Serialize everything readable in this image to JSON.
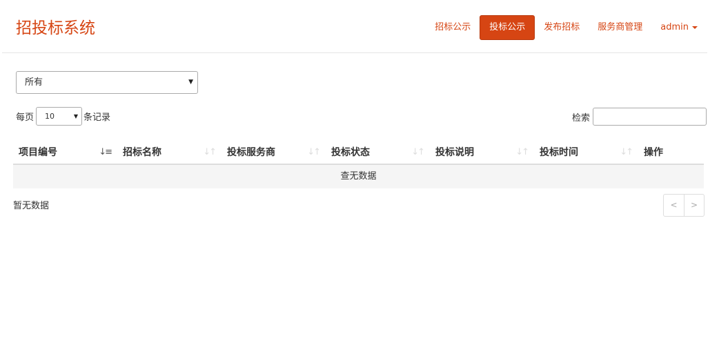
{
  "app": {
    "title": "招投标系统"
  },
  "nav": {
    "items": [
      {
        "label": "招标公示",
        "active": false
      },
      {
        "label": "投标公示",
        "active": true
      },
      {
        "label": "发布招标",
        "active": false
      },
      {
        "label": "服务商管理",
        "active": false
      }
    ],
    "user": "admin"
  },
  "filter": {
    "selected": "所有"
  },
  "length": {
    "prefix": "每页",
    "value": "10",
    "suffix": "条记录"
  },
  "search": {
    "label": "检索",
    "value": ""
  },
  "table": {
    "columns": [
      {
        "label": "项目编号",
        "sort": "asc"
      },
      {
        "label": "招标名称",
        "sort": "both"
      },
      {
        "label": "投标服务商",
        "sort": "both"
      },
      {
        "label": "投标状态",
        "sort": "both"
      },
      {
        "label": "投标说明",
        "sort": "both"
      },
      {
        "label": "投标时间",
        "sort": "both"
      },
      {
        "label": "操作",
        "sort": "none"
      }
    ],
    "empty_text": "查无数据"
  },
  "info": "暂无数据",
  "pager": {
    "prev": "<",
    "next": ">"
  },
  "colors": {
    "brand": "#d64513",
    "border": "#dddddd"
  },
  "icons": {
    "sort_asc": "sort-amount-asc-icon",
    "sort_both": "sort-icon",
    "dropdown": "caret-down-icon"
  }
}
